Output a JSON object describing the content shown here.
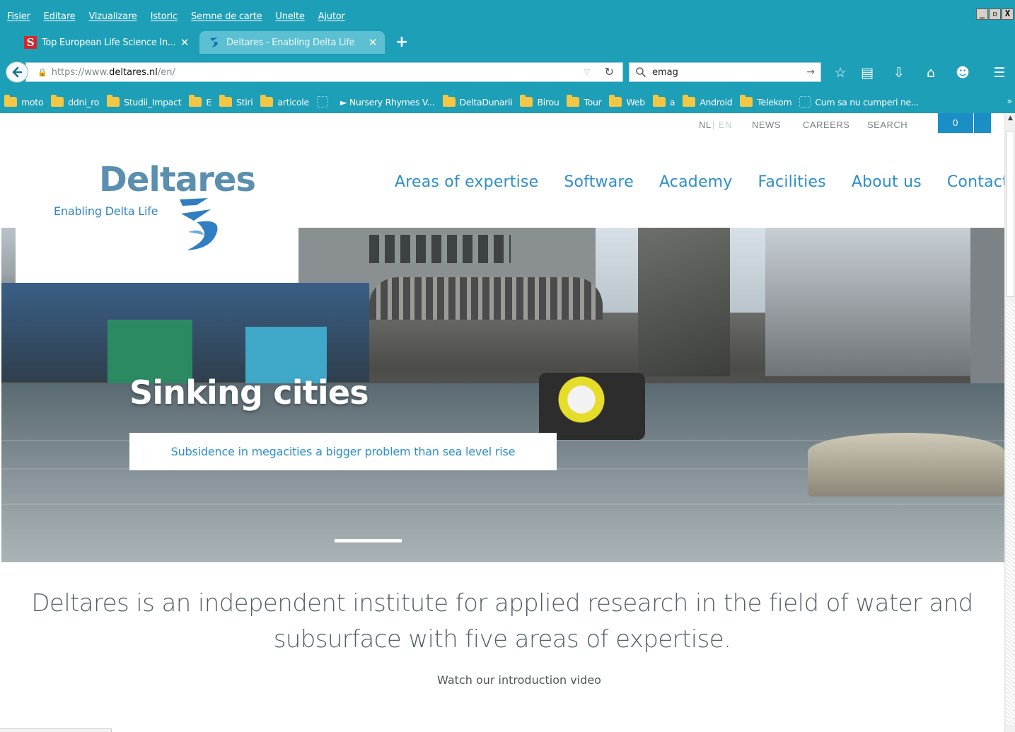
{
  "browser": {
    "menu": [
      "Fișier",
      "Editare",
      "Vizualizare",
      "Istoric",
      "Semne de carte",
      "Unelte",
      "Ajutor"
    ],
    "window_controls": [
      "_",
      "▫",
      "X"
    ],
    "tabs": [
      {
        "title": "Top European Life Science In...",
        "favicon": "s-logo-icon",
        "active": false
      },
      {
        "title": "Deltares - Enabling Delta Life",
        "favicon": "deltares-icon",
        "active": true
      }
    ],
    "new_tab": "+",
    "url": {
      "scheme": "https://www.",
      "host": "deltares.nl",
      "path": "/en/"
    },
    "search_value": "emag",
    "bookmarks": [
      {
        "label": "moto",
        "type": "folder"
      },
      {
        "label": "ddni_ro",
        "type": "folder"
      },
      {
        "label": "Studii_Impact",
        "type": "folder"
      },
      {
        "label": "E",
        "type": "folder"
      },
      {
        "label": "Stiri",
        "type": "folder"
      },
      {
        "label": "articole",
        "type": "folder"
      },
      {
        "label": "",
        "type": "page"
      },
      {
        "label": "► Nursery Rhymes V...",
        "type": "text"
      },
      {
        "label": "DeltaDunarii",
        "type": "folder"
      },
      {
        "label": "Birou",
        "type": "folder"
      },
      {
        "label": "Tour",
        "type": "folder"
      },
      {
        "label": "Web",
        "type": "folder"
      },
      {
        "label": "a",
        "type": "folder"
      },
      {
        "label": "Android",
        "type": "folder"
      },
      {
        "label": "Telekom",
        "type": "folder"
      },
      {
        "label": "Cum sa nu cumperi ne...",
        "type": "page"
      }
    ],
    "bookmarks_overflow": "»",
    "colors": {
      "chrome": "#1e9fb8",
      "active_tab": "#5cc0d2"
    }
  },
  "site": {
    "utility": {
      "lang_nl": "NL",
      "lang_sep": "|",
      "lang_en": "EN",
      "news": "NEWS",
      "careers": "CAREERS",
      "search": "SEARCH",
      "cart_count": "0"
    },
    "logo": {
      "wordmark": "Deltares",
      "tagline": "Enabling Delta Life"
    },
    "nav": [
      "Areas of expertise",
      "Software",
      "Academy",
      "Facilities",
      "About us",
      "Contact"
    ],
    "hero": {
      "title": "Sinking cities",
      "subtitle": "Subsidence in megacities a bigger problem than sea level rise"
    },
    "intro": {
      "line1": "Deltares is an independent institute for applied research in the field of water and",
      "line2": "subsurface with five areas of expertise.",
      "video_link": "Watch our introduction video"
    },
    "colors": {
      "brand_blue": "#2e8fc7",
      "logo_grey_blue": "#5b8fb0",
      "cart": "#1a8ec5"
    }
  }
}
